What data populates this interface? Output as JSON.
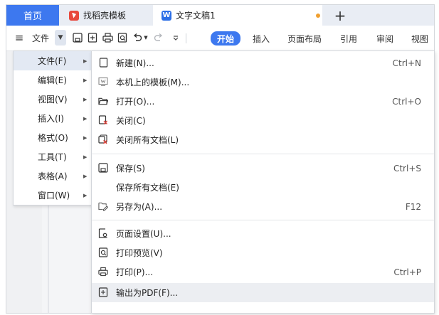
{
  "tabs": {
    "home": "首页",
    "templates": "找稻壳模板",
    "document": "文字文稿1",
    "add": "+"
  },
  "toolbar": {
    "menu_label": "文件",
    "ribbon_tabs": [
      "开始",
      "插入",
      "页面布局",
      "引用",
      "审阅",
      "视图"
    ]
  },
  "main_menu": {
    "items": [
      {
        "label": "文件(F)"
      },
      {
        "label": "编辑(E)"
      },
      {
        "label": "视图(V)"
      },
      {
        "label": "插入(I)"
      },
      {
        "label": "格式(O)"
      },
      {
        "label": "工具(T)"
      },
      {
        "label": "表格(A)"
      },
      {
        "label": "窗口(W)"
      }
    ]
  },
  "file_menu": {
    "items": [
      {
        "label": "新建(N)...",
        "shortcut": "Ctrl+N",
        "icon": "new-doc-icon"
      },
      {
        "label": "本机上的模板(M)...",
        "shortcut": "",
        "icon": "template-icon"
      },
      {
        "label": "打开(O)...",
        "shortcut": "Ctrl+O",
        "icon": "open-folder-icon"
      },
      {
        "label": "关闭(C)",
        "shortcut": "",
        "icon": "close-doc-icon"
      },
      {
        "label": "关闭所有文档(L)",
        "shortcut": "",
        "icon": "close-all-icon"
      },
      {
        "label": "保存(S)",
        "shortcut": "Ctrl+S",
        "icon": "save-icon"
      },
      {
        "label": "保存所有文档(E)",
        "shortcut": "",
        "icon": ""
      },
      {
        "label": "另存为(A)...",
        "shortcut": "F12",
        "icon": "save-as-icon"
      },
      {
        "label": "页面设置(U)...",
        "shortcut": "",
        "icon": "page-setup-icon"
      },
      {
        "label": "打印预览(V)",
        "shortcut": "",
        "icon": "print-preview-icon"
      },
      {
        "label": "打印(P)...",
        "shortcut": "Ctrl+P",
        "icon": "print-icon"
      },
      {
        "label": "输出为PDF(F)...",
        "shortcut": "",
        "icon": "export-pdf-icon"
      }
    ]
  },
  "colors": {
    "accent": "#3d78ef",
    "unsaved_dot": "#f0a030",
    "templates_icon": "#e8483c"
  }
}
